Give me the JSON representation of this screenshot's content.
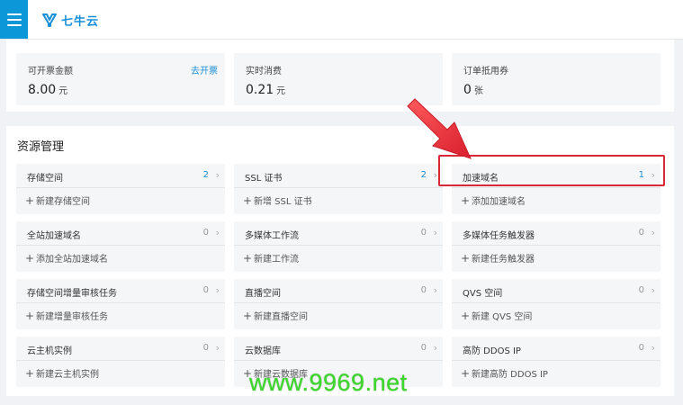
{
  "header": {
    "logo_text": "七牛云"
  },
  "summary": [
    {
      "label": "可开票金额",
      "link": "去开票",
      "value": "8.00",
      "unit": "元"
    },
    {
      "label": "实时消费",
      "link": "",
      "value": "0.21",
      "unit": "元"
    },
    {
      "label": "订单抵用券",
      "link": "",
      "value": "0",
      "unit": "张"
    }
  ],
  "resources": {
    "title": "资源管理",
    "items": [
      {
        "name": "存储空间",
        "count": "2",
        "add": "新建存储空间"
      },
      {
        "name": "SSL 证书",
        "count": "2",
        "add": "新增 SSL 证书"
      },
      {
        "name": "加速域名",
        "count": "1",
        "add": "添加加速域名"
      },
      {
        "name": "全站加速域名",
        "count": "0",
        "add": "添加全站加速域名"
      },
      {
        "name": "多媒体工作流",
        "count": "0",
        "add": "新建工作流"
      },
      {
        "name": "多媒体任务触发器",
        "count": "0",
        "add": "新建任务触发器"
      },
      {
        "name": "存储空间增量审核任务",
        "count": "0",
        "add": "新建增量审核任务"
      },
      {
        "name": "直播空间",
        "count": "0",
        "add": "新建直播空间"
      },
      {
        "name": "QVS 空间",
        "count": "0",
        "add": "新建 QVS 空间"
      },
      {
        "name": "云主机实例",
        "count": "0",
        "add": "新建云主机实例"
      },
      {
        "name": "云数据库",
        "count": "0",
        "add": "新建云数据库"
      },
      {
        "name": "高防 DDOS IP",
        "count": "0",
        "add": "新建高防 DDOS IP"
      }
    ]
  },
  "watermark": "www.9969.net",
  "colors": {
    "accent": "#1a8fd8",
    "menu": "#0c98d8",
    "highlight": "#d8283a",
    "arrow": "#e8283a",
    "watermark": "#3fd62f"
  }
}
